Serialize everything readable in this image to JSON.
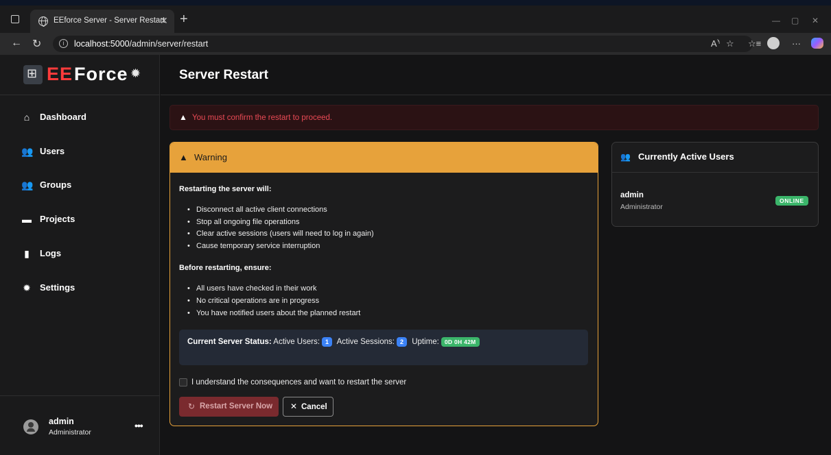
{
  "browser": {
    "tab_title": "EEforce Server - Server Restart",
    "tab_close": "✕",
    "new_tab": "+",
    "url_host": "localhost:5000",
    "url_path": "/admin/server/restart",
    "window_controls": [
      "—",
      "▢",
      "✕"
    ],
    "toolbar_icons": [
      "read-aloud-icon",
      "favorite-icon",
      "favorites-bar-icon",
      "profile-icon",
      "more-icon",
      "copilot-icon"
    ]
  },
  "brand": {
    "part1": "EE",
    "part2": "Force"
  },
  "sidebar": {
    "items": [
      {
        "label": "Dashboard",
        "icon": "home-icon"
      },
      {
        "label": "Users",
        "icon": "users-icon"
      },
      {
        "label": "Groups",
        "icon": "groups-icon"
      },
      {
        "label": "Projects",
        "icon": "folder-icon"
      },
      {
        "label": "Logs",
        "icon": "file-icon"
      },
      {
        "label": "Settings",
        "icon": "gear-icon"
      }
    ],
    "user": {
      "name": "admin",
      "role": "Administrator",
      "more": "•••"
    }
  },
  "page": {
    "title": "Server Restart"
  },
  "alert": {
    "text": "You must confirm the restart to proceed."
  },
  "warning": {
    "title": "Warning",
    "section1_title": "Restarting the server will:",
    "section1_items": [
      "Disconnect all active client connections",
      "Stop all ongoing file operations",
      "Clear active sessions (users will need to log in again)",
      "Cause temporary service interruption"
    ],
    "section2_title": "Before restarting, ensure:",
    "section2_items": [
      "All users have checked in their work",
      "No critical operations are in progress",
      "You have notified users about the planned restart"
    ],
    "status": {
      "label": "Current Server Status:",
      "active_users_label": "Active Users:",
      "active_users": "1",
      "active_sessions_label": "Active Sessions:",
      "active_sessions": "2",
      "uptime_label": "Uptime:",
      "uptime": "0D 0H 42M"
    },
    "confirm_label": "I understand the consequences and want to restart the server",
    "confirm_checked": false,
    "restart_button": "Restart Server Now",
    "cancel_button": "Cancel"
  },
  "active_users": {
    "title": "Currently Active Users",
    "users": [
      {
        "name": "admin",
        "role": "Administrator",
        "status": "ONLINE"
      }
    ]
  },
  "colors": {
    "warning": "#e7a23b",
    "danger_text": "#ea4a55",
    "online": "#3bb56a",
    "badge_blue": "#3b82f6",
    "brand_red": "#ff3b3b"
  }
}
